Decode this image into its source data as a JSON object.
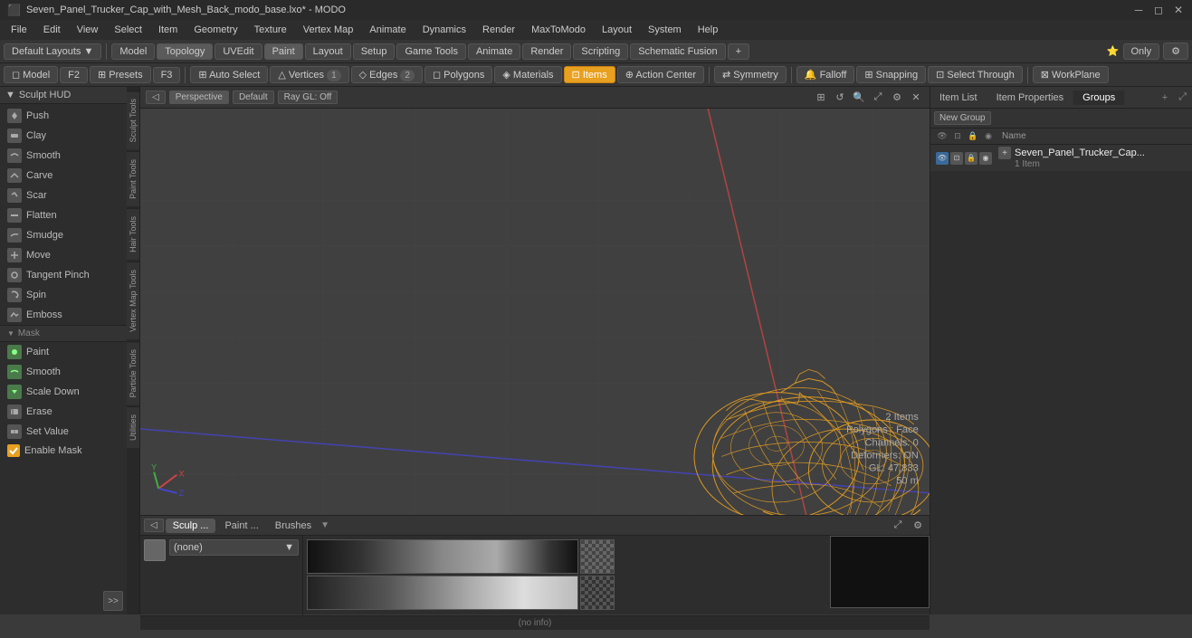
{
  "titlebar": {
    "title": "Seven_Panel_Trucker_Cap_with_Mesh_Back_modo_base.lxo* - MODO",
    "controls": [
      "minimize",
      "maximize",
      "close"
    ]
  },
  "menubar": {
    "items": [
      "File",
      "Edit",
      "View",
      "Select",
      "Item",
      "Geometry",
      "Texture",
      "Vertex Map",
      "Animate",
      "Dynamics",
      "Render",
      "MaxToModo",
      "Layout",
      "System",
      "Help"
    ]
  },
  "toolbar1": {
    "layout_label": "Default Layouts",
    "mode_buttons": [
      "Model",
      "Topology",
      "UVEdit",
      "Paint",
      "Layout",
      "Setup",
      "Game Tools",
      "Animate",
      "Render",
      "Scripting",
      "Schematic Fusion"
    ],
    "active_mode": "Paint",
    "only_label": "Only",
    "settings_icon": "⚙"
  },
  "toolbar2": {
    "model_label": "Model",
    "f2_label": "F2",
    "presets_label": "Presets",
    "f3_label": "F3",
    "buttons": [
      "Auto Select",
      "Vertices",
      "Edges",
      "Polygons",
      "Materials",
      "Items",
      "Action Center",
      "Symmetry",
      "Falloff",
      "Snapping",
      "Select Through",
      "WorkPlane"
    ],
    "active": "Items",
    "vertices_count": "1",
    "edges_count": "2"
  },
  "sculpt_tools": {
    "header": "Sculpt HUD",
    "tools": [
      {
        "name": "Push",
        "icon": "push"
      },
      {
        "name": "Clay",
        "icon": "clay"
      },
      {
        "name": "Smooth",
        "icon": "smooth"
      },
      {
        "name": "Carve",
        "icon": "carve"
      },
      {
        "name": "Scar",
        "icon": "scar"
      },
      {
        "name": "Flatten",
        "icon": "flatten"
      },
      {
        "name": "Smudge",
        "icon": "smudge"
      },
      {
        "name": "Move",
        "icon": "move"
      },
      {
        "name": "Tangent Pinch",
        "icon": "tangent-pinch"
      },
      {
        "name": "Spin",
        "icon": "spin"
      },
      {
        "name": "Emboss",
        "icon": "emboss"
      }
    ],
    "mask_section": "Mask",
    "mask_tools": [
      {
        "name": "Paint",
        "icon": "paint"
      },
      {
        "name": "Smooth",
        "icon": "smooth"
      },
      {
        "name": "Scale Down",
        "icon": "scale-down"
      }
    ],
    "other_tools": [
      {
        "name": "Erase",
        "icon": "erase"
      },
      {
        "name": "Set Value",
        "icon": "set-value"
      },
      {
        "name": "Enable Mask",
        "icon": "enable-mask",
        "checkbox": true
      }
    ]
  },
  "vert_tabs": [
    "Sculpt Tools",
    "Paint Tools",
    "Hair Tools",
    "Vertex Map Tools",
    "Particle Tools",
    "Utilities"
  ],
  "viewport": {
    "mode_label": "Perspective",
    "style_label": "Default",
    "render_label": "Ray GL: Off",
    "info": {
      "items": "2 Items",
      "polygons": "Polygons : Face",
      "channels": "Channels: 0",
      "deformers": "Deformers: ON",
      "gl": "GL: 47,833",
      "distance": "50 m"
    }
  },
  "bottom_panel": {
    "tabs": [
      "Sculp ...",
      "Paint ...",
      "Brushes"
    ],
    "active_tab": "Sculp ...",
    "preset_color": "(none)",
    "no_info": "(no info)"
  },
  "right_panel": {
    "tabs": [
      "Item List",
      "Item Properties",
      "Groups"
    ],
    "active_tab": "Groups",
    "new_group_label": "New Group",
    "name_col": "Name",
    "group_name": "Seven_Panel_Trucker_Cap...",
    "group_sub": "1 Item"
  }
}
